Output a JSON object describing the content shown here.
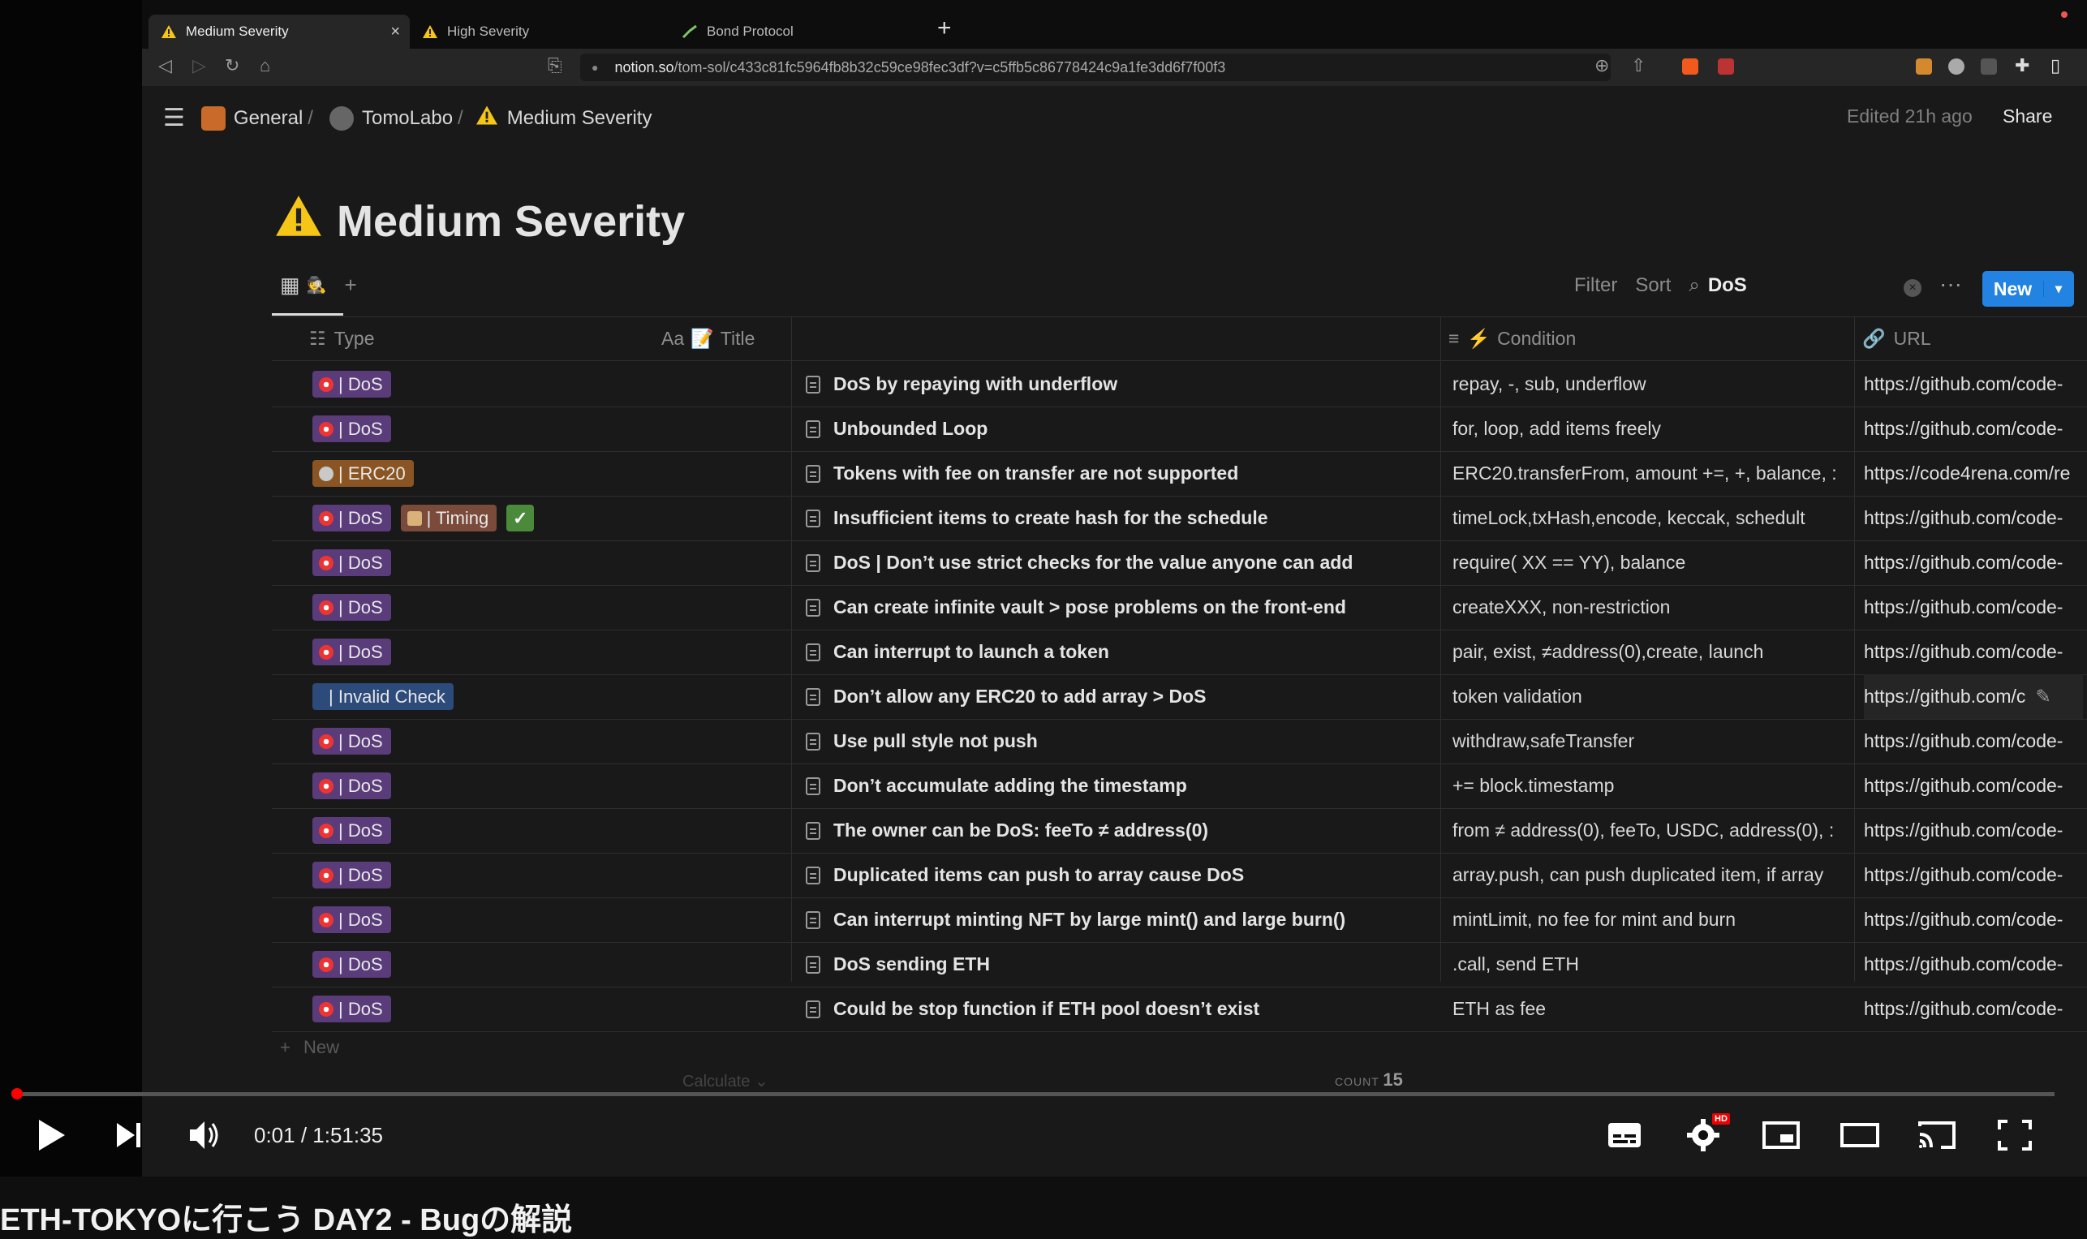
{
  "browser": {
    "tabs": [
      {
        "label": "Medium Severity",
        "icon": "warning-icon",
        "active": true
      },
      {
        "label": "High Severity",
        "icon": "warning-icon",
        "active": false
      },
      {
        "label": "Bond Protocol",
        "icon": "bond-icon",
        "active": false
      }
    ],
    "url_host": "notion.so",
    "url_path": "/tom-sol/c433c81fc5964fb8b32c59ce98fec3df?v=c5ffb5c86778424c9a1fe3dd6f7f00f3"
  },
  "notion": {
    "breadcrumb": [
      "General",
      "TomoLabo",
      "Medium Severity"
    ],
    "edited": "Edited 21h ago",
    "share": "Share",
    "page_title": "Medium Severity",
    "toolbar": {
      "filter": "Filter",
      "sort": "Sort",
      "search_value": "DoS",
      "new": "New"
    },
    "columns": {
      "type": "Type",
      "title": "Title",
      "condition": "Condition",
      "url": "URL",
      "title_prefix": "Aa",
      "cond_prefix": "⚡"
    },
    "rows": [
      {
        "tags": [
          "DoS"
        ],
        "title": "DoS by repaying with underflow",
        "condition": "repay, -, sub, underflow",
        "url": "https://github.com/code-"
      },
      {
        "tags": [
          "DoS"
        ],
        "title": "Unbounded Loop",
        "condition": "for, loop, add items freely",
        "url": "https://github.com/code-"
      },
      {
        "tags": [
          "ERC20"
        ],
        "title": "Tokens with fee on transfer are not supported",
        "condition": "ERC20.transferFrom, amount +=, +, balance, :",
        "url": "https://code4rena.com/re"
      },
      {
        "tags": [
          "DoS",
          "Timing",
          "check"
        ],
        "title": "Insufficient items to create hash for the schedule",
        "condition": "timeLock,txHash,encode, keccak, schedult",
        "url": "https://github.com/code-"
      },
      {
        "tags": [
          "DoS"
        ],
        "title": "DoS | Don’t use strict checks for the value anyone can add",
        "condition": "require( XX == YY), balance",
        "url": "https://github.com/code-"
      },
      {
        "tags": [
          "DoS"
        ],
        "title": "Can create infinite vault > pose problems on the front-end",
        "condition": "createXXX, non-restriction",
        "url": "https://github.com/code-"
      },
      {
        "tags": [
          "DoS"
        ],
        "title": "Can interrupt to launch a token",
        "condition": "pair, exist, ≠address(0),create, launch",
        "url": "https://github.com/code-"
      },
      {
        "tags": [
          "Invalid Check"
        ],
        "title": "Don’t allow any ERC20 to add array > DoS",
        "condition": "token validation",
        "url": "https://github.com/c"
      },
      {
        "tags": [
          "DoS"
        ],
        "title": "Use pull style not push",
        "condition": "withdraw,safeTransfer",
        "url": "https://github.com/code-"
      },
      {
        "tags": [
          "DoS"
        ],
        "title": "Don’t accumulate adding the timestamp",
        "condition": "+= block.timestamp",
        "url": "https://github.com/code-"
      },
      {
        "tags": [
          "DoS"
        ],
        "title": "The owner can be DoS: feeTo ≠ address(0)",
        "condition": "from ≠ address(0), feeTo, USDC, address(0), :",
        "url": "https://github.com/code-"
      },
      {
        "tags": [
          "DoS"
        ],
        "title": "Duplicated items can push to array cause DoS",
        "condition": "array.push, can push duplicated item, if array",
        "url": "https://github.com/code-"
      },
      {
        "tags": [
          "DoS"
        ],
        "title": "Can interrupt minting NFT by large mint() and large burn()",
        "condition": "mintLimit, no fee for mint and burn",
        "url": "https://github.com/code-"
      },
      {
        "tags": [
          "DoS"
        ],
        "title": "DoS sending ETH",
        "condition": ".call, send ETH",
        "url": "https://github.com/code-"
      },
      {
        "tags": [
          "DoS"
        ],
        "title": "Could be stop function if ETH pool doesn’t exist",
        "condition": "ETH as fee",
        "url": "https://github.com/code-"
      }
    ],
    "add_new": "New",
    "calculate": "Calculate",
    "count_label": "COUNT",
    "count_value": "15",
    "tag_labels": {
      "DoS": "| DoS",
      "ERC20": "| ERC20",
      "Timing": "| Timing",
      "Invalid Check": "| Invalid Check",
      "check": "✓"
    }
  },
  "player": {
    "time": "0:01 / 1:51:35",
    "progress": 0.0002,
    "hd_badge": "HD",
    "video_title": "ETH-TOKYOに行こう DAY2 - Bugの解説"
  }
}
